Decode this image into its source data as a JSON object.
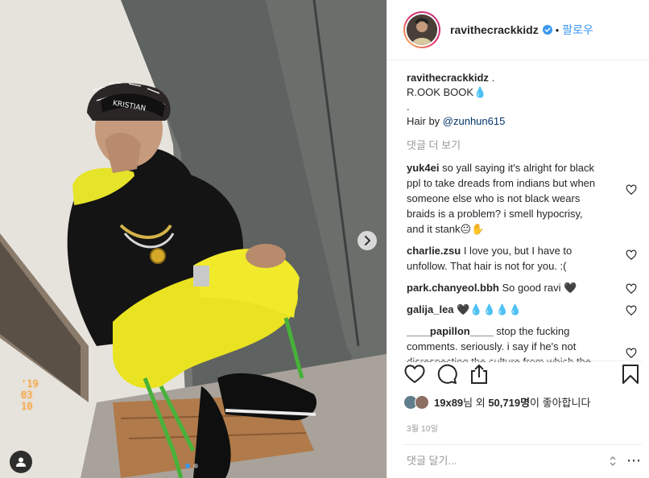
{
  "photo": {
    "date_stamp": "'19 03 10",
    "carousel": {
      "count": 2,
      "active": 0
    },
    "headband_text": "KRISTIAN"
  },
  "post": {
    "author": "ravithecrackkidz",
    "follow_label": "팔로우",
    "separator": "•",
    "caption": {
      "username": "ravithecrackkidz",
      "suffix": " .",
      "line1": "R.OOK BOOK💧",
      "line2": ".",
      "line3_prefix": "Hair by ",
      "line3_mention": "@zunhun615"
    },
    "view_more_label": "댓글 더 보기"
  },
  "comments": [
    {
      "user": "yuk4ei",
      "text": "so yall saying it's alright for black ppl to take dreads from indians but when someone else who is not black wears braids is a problem? i smell hypocrisy, and it stank😐✋"
    },
    {
      "user": "charlie.zsu",
      "text": "I love you, but I have to unfollow. That hair is not for you. :("
    },
    {
      "user": "park.chanyeol.bbh",
      "text": "So good ravi 🖤"
    },
    {
      "user": "galija_lea",
      "text": "🖤💧💧💧💧"
    },
    {
      "user": "____papillon____",
      "text": "stop the fucking comments. seriously. i say if he's not disrespecting the culture from which the hairstyle came, you should be"
    }
  ],
  "likes": {
    "prefix_user": "19x89",
    "middle": "님 외 ",
    "count": "50,719명",
    "suffix": "이 좋아합니다"
  },
  "date": "3월 10일",
  "add_comment": {
    "placeholder": "댓글 달기..."
  },
  "colors": {
    "link": "#3897f0",
    "muted": "#999999",
    "text": "#262626"
  }
}
